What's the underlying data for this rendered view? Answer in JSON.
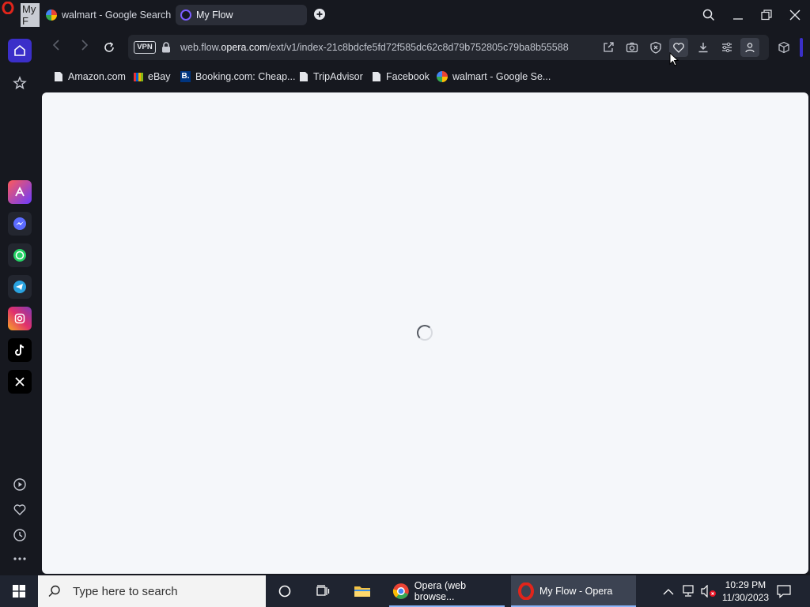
{
  "window_title": "My F",
  "tabs": [
    {
      "label": "walmart - Google Search",
      "active": false,
      "favicon": "google-g-icon"
    },
    {
      "label": "My Flow",
      "active": true,
      "favicon": "opera-flow-icon"
    }
  ],
  "address": {
    "vpn_label": "VPN",
    "url_prefix": "web.flow.",
    "url_domain": "opera.com",
    "url_rest": "/ext/v1/index-21c8bdcfe5fd72f585dc62c8d79b752805c79ba8b55588"
  },
  "bookmarks": [
    {
      "label": "Amazon.com",
      "icon": "page-icon"
    },
    {
      "label": "eBay",
      "icon": "ebay-icon"
    },
    {
      "label": "Booking.com: Cheap...",
      "icon": "booking-icon"
    },
    {
      "label": "TripAdvisor",
      "icon": "page-icon"
    },
    {
      "label": "Facebook",
      "icon": "page-icon"
    },
    {
      "label": "walmart - Google Se...",
      "icon": "google-g-icon"
    }
  ],
  "taskbar": {
    "search_placeholder": "Type here to search",
    "apps": [
      {
        "label": "Opera (web browse...",
        "icon": "chrome-icon",
        "active": false
      },
      {
        "label": "My Flow - Opera",
        "icon": "opera-icon",
        "active": true
      }
    ],
    "time": "10:29 PM",
    "date": "11/30/2023"
  },
  "colors": {
    "accent": "#3b2fc9",
    "chrome_bg": "#16181f",
    "page_bg": "#f5f7fa",
    "taskbar_bg": "#1f2430"
  }
}
